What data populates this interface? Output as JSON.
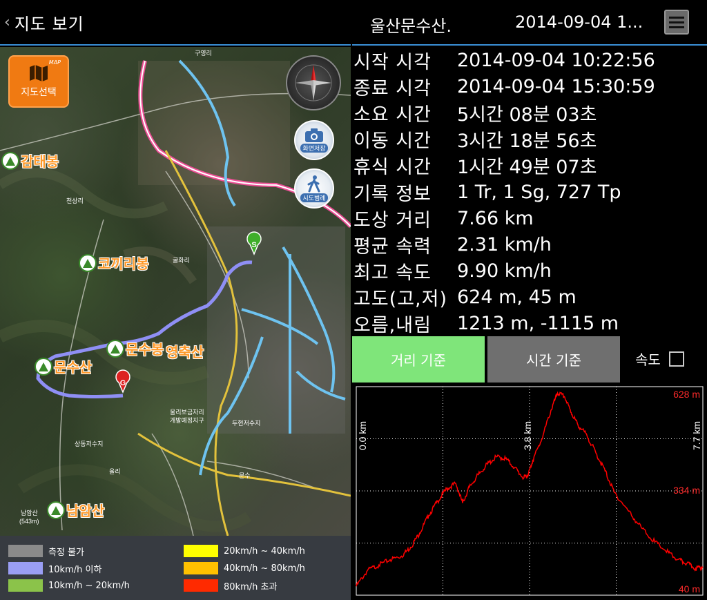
{
  "left_header": {
    "back_icon": "chevron-left-icon",
    "title": "지도 보기"
  },
  "map": {
    "select_button": {
      "label": "지도선택",
      "badge": "MAP"
    },
    "camera_button": {
      "label": "화면저장"
    },
    "hiker_button": {
      "label": "시도범례"
    },
    "start_marker": "S",
    "goal_marker": "G",
    "peaks": [
      {
        "id": "gamtae",
        "name": "감태봉"
      },
      {
        "id": "kokkiri",
        "name": "코끼리봉"
      },
      {
        "id": "munsubong",
        "name": "문수봉"
      },
      {
        "id": "yeongchuk",
        "name": "영축산"
      },
      {
        "id": "munsusan",
        "name": "문수산"
      },
      {
        "id": "namamsan",
        "name": "남암산"
      }
    ],
    "place_labels": [
      "구영리",
      "천상리",
      "굴화리",
      "율리",
      "두현저수지",
      "울리보금자리",
      "개발예정지구",
      "상동저수지",
      "문수",
      "남암산",
      "(543m)"
    ]
  },
  "legend": [
    {
      "label": "측정 불가",
      "color": "#8a8a8a"
    },
    {
      "label": "10km/h 이하",
      "color": "#9a9ef4"
    },
    {
      "label": "10km/h ~ 20km/h",
      "color": "#8bc34a"
    },
    {
      "label": "20km/h ~ 40km/h",
      "color": "#ffff00"
    },
    {
      "label": "40km/h ~ 80km/h",
      "color": "#ffc000"
    },
    {
      "label": "80km/h 초과",
      "color": "#ff2a00"
    }
  ],
  "right_header": {
    "track_name": "울산문수산.",
    "track_date": "2014-09-04 1...",
    "menu_icon": "menu-list-icon"
  },
  "stats": [
    {
      "label": "시작 시각",
      "value": "2014-09-04 10:22:56"
    },
    {
      "label": "종료 시각",
      "value": "2014-09-04 15:30:59"
    },
    {
      "label": "소요 시간",
      "value": "5시간 08분 03초"
    },
    {
      "label": "이동 시간",
      "value": "3시간 18분 56초"
    },
    {
      "label": "휴식 시간",
      "value": "1시간 49분 07초"
    },
    {
      "label": "기록 정보",
      "value": "1 Tr, 1 Sg, 727 Tp"
    },
    {
      "label": "도상 거리",
      "value": "7.66 km"
    },
    {
      "label": "평균 속력",
      "value": "2.31 km/h"
    },
    {
      "label": "최고 속도",
      "value": "9.90 km/h"
    },
    {
      "label": "고도(고,저)",
      "value": "624 m, 45 m"
    },
    {
      "label": "오름,내림",
      "value": "1213 m, -1115 m"
    }
  ],
  "tabs": {
    "distance": "거리 기준",
    "time": "시간 기준"
  },
  "speed_toggle": {
    "label": "속도",
    "checked": false
  },
  "chart_data": {
    "type": "line",
    "xlabel": "",
    "ylabel": "",
    "x_tick_labels": [
      "0.0 km",
      "3.8 km",
      "7.7 km"
    ],
    "y_tick_labels": [
      "628 m",
      "334 m",
      "40 m"
    ],
    "x_range_km": [
      0,
      7.66
    ],
    "y_range_m": [
      40,
      628
    ],
    "grid": true,
    "line_color": "#ff0000",
    "series": [
      {
        "x": [
          0.0,
          0.25,
          0.5,
          0.75,
          1.0,
          1.2,
          1.4,
          1.6,
          1.8,
          2.0,
          2.2,
          2.35,
          2.5,
          2.7,
          2.9,
          3.1,
          3.3,
          3.5,
          3.7,
          3.8,
          3.9,
          4.1,
          4.3,
          4.45,
          4.6,
          4.75,
          4.9,
          5.1,
          5.3,
          5.5,
          5.7,
          6.0,
          6.3,
          6.6,
          6.9,
          7.1,
          7.3,
          7.5,
          7.66
        ],
        "y": [
          65,
          110,
          125,
          140,
          150,
          175,
          215,
          265,
          305,
          340,
          355,
          300,
          345,
          380,
          410,
          430,
          425,
          400,
          370,
          380,
          420,
          480,
          560,
          610,
          600,
          555,
          520,
          490,
          440,
          390,
          330,
          280,
          230,
          190,
          160,
          140,
          130,
          115,
          120
        ]
      }
    ]
  }
}
